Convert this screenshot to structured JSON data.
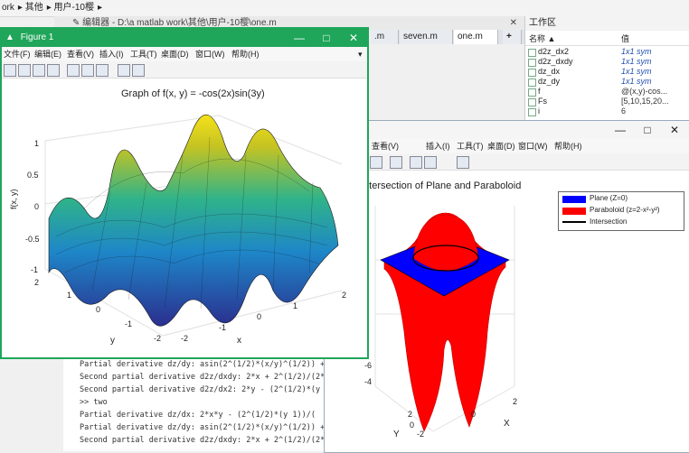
{
  "breadcrumb": {
    "items": [
      "ork",
      "其他",
      "用户-10樱"
    ]
  },
  "editor": {
    "title": "编辑器 - D:\\a matlab work\\其他\\用户-10樱\\one.m",
    "tabs": [
      ".m",
      "seven.m",
      "one.m",
      "+"
    ]
  },
  "workspace": {
    "title": "工作区",
    "col_name": "名称 ▲",
    "col_value": "值",
    "rows": [
      {
        "name": "d2z_dx2",
        "value": "1x1 sym"
      },
      {
        "name": "d2z_dxdy",
        "value": "1x1 sym"
      },
      {
        "name": "dz_dx",
        "value": "1x1 sym"
      },
      {
        "name": "dz_dy",
        "value": "1x1 sym"
      },
      {
        "name": "f",
        "value": "@(x,y)-cos..."
      },
      {
        "name": "Fs",
        "value": "[5,10,15,20..."
      },
      {
        "name": "i",
        "value": "6"
      }
    ]
  },
  "command_window": {
    "lines": [
      "Partial derivative dz/dy: asin(2^(1/2)*(x/y)^(1/2)) +",
      "Second partial derivative d2z/dxdy: 2*x + 2^(1/2)/(2*",
      "Second partial derivative d2z/dx2: 2*y - (2^(1/2)*(y",
      ">> two",
      "Partial derivative dz/dx: 2*x*y - (2^(1/2)*(y   1))/(",
      "Partial derivative dz/dy: asin(2^(1/2)*(x/y)^(1/2)) +",
      "Second partial derivative d2z/dxdy: 2*x + 2^(1/2)/(2*"
    ]
  },
  "figure1": {
    "window_title": "Figure 1",
    "menus": [
      "文件(F)",
      "编辑(E)",
      "查看(V)",
      "插入(I)",
      "工具(T)",
      "桌面(D)",
      "窗口(W)",
      "帮助(H)"
    ],
    "controls": {
      "minimize": "—",
      "maximize": "□",
      "close": "✕"
    },
    "plot_title": "Graph of f(x, y) = -cos(2x)sin(3y)",
    "xlabel": "x",
    "ylabel": "y",
    "zlabel": "f(x, y)",
    "zticks": [
      "1",
      "0.5",
      "0",
      "-0.5",
      "-1"
    ],
    "yticks": [
      "2",
      "1",
      "0",
      "-1",
      "-2"
    ],
    "xticks": [
      "-2",
      "-1",
      "0",
      "1",
      "2"
    ]
  },
  "figure2": {
    "menus": [
      "查看(V)",
      "插入(I)",
      "工具(T)",
      "桌面(D)",
      "窗口(W)",
      "帮助(H)"
    ],
    "controls": {
      "minimize": "—",
      "maximize": "□",
      "close": "✕"
    },
    "plot_title": "Intersection of Plane and Paraboloid",
    "legend": [
      {
        "label": "Plane (Z=0)",
        "color": "#0000ff"
      },
      {
        "label": "Paraboloid (z=2-x²-y²)",
        "color": "#ff0000"
      },
      {
        "label": "Intersection",
        "color": "#000000"
      }
    ],
    "zticks": [
      "-4",
      "-6"
    ],
    "yticks": [
      "2",
      "0",
      "-2"
    ],
    "xticks": [
      "0",
      "2"
    ],
    "ylabel": "Y",
    "xlabel": "X"
  },
  "colors": {
    "figure_titlebar": "#1fa65a",
    "plane": "#0000ff",
    "paraboloid": "#ff0000"
  }
}
